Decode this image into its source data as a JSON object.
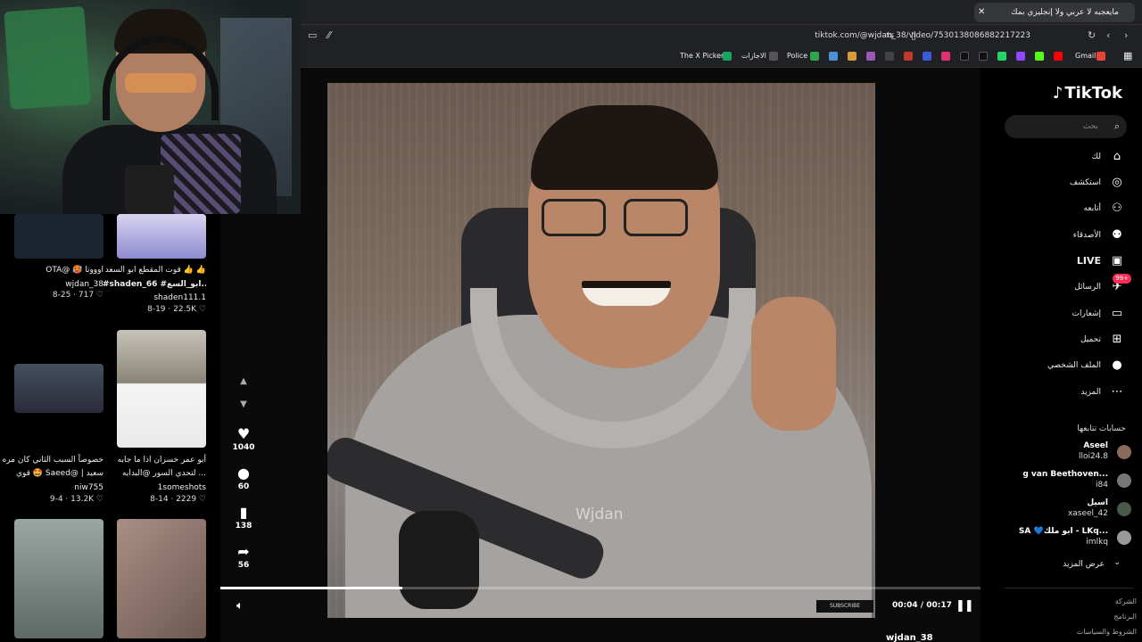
{
  "browser": {
    "tab_title": "مايعجبه لا عربي ولا إنجليزي بمك",
    "tab_close": "✕",
    "new_tab": "+",
    "url": "tiktok.com/@wjdan_38/video/7530138086882217223",
    "bookmarks": [
      "Gmail",
      "Police",
      "الاجازات",
      "The X Picker"
    ]
  },
  "video": {
    "watermark": "Wjdan",
    "subscribe_sticker": "SUBSCRIBE",
    "time": "00:04 / 00:17",
    "progress_fraction": 0.24,
    "author": "wjdan_38"
  },
  "actions": {
    "likes": "1040",
    "comments": "60",
    "saves": "138",
    "shares": "56"
  },
  "grid": {
    "cards": [
      {
        "caption": "OTA@ 🥵 اوووتا",
        "user": "wjdan_38",
        "meta": "8-25 · 717 ♡"
      },
      {
        "caption": "قوت المقطع ابو السعد 👍 👍",
        "caption2": "#shaden_66 #ابو_السع...",
        "user": "shaden111.1",
        "meta": "8-19 · 22.5K ♡"
      },
      {
        "caption": "خصوصاً السبب الثاني كان مره",
        "caption2": "قوي 🤩 Saeed@ | سعيد",
        "user": "niw755",
        "meta": "9-4 · 13.2K ♡"
      },
      {
        "caption": "أبو عمر خسران اذا ما جابه",
        "caption2": "لتحدي السور @البدايه ...",
        "user": "1someshots",
        "meta": "8-14 · 2229 ♡"
      }
    ]
  },
  "sidebar": {
    "logo": "TikTok",
    "search_placeholder": "بحث",
    "items": [
      {
        "label": "لك",
        "icon": "home-icon"
      },
      {
        "label": "استكشف",
        "icon": "compass-icon"
      },
      {
        "label": "أتابعه",
        "icon": "user-follow-icon"
      },
      {
        "label": "الأصدقاء",
        "icon": "friends-icon"
      },
      {
        "label": "LIVE",
        "icon": "live-icon"
      },
      {
        "label": "الرسائل",
        "icon": "messages-icon",
        "badge": "99+"
      },
      {
        "label": "إشعارات",
        "icon": "inbox-icon"
      },
      {
        "label": "تحميل",
        "icon": "upload-icon"
      },
      {
        "label": "الملف الشخصي",
        "icon": "profile-icon"
      },
      {
        "label": "المزيد",
        "icon": "more-icon"
      }
    ],
    "following_title": "حسابات تتابعها",
    "following": [
      {
        "name": "Aseel",
        "handle": "lloi24.8"
      },
      {
        "name": "g van Beethoven...",
        "handle": "i84"
      },
      {
        "name": "اسيل",
        "handle": "xaseel_42"
      },
      {
        "name": "SA 💙ابو ملك - LKq...",
        "handle": "imlkq"
      }
    ],
    "see_more": "عرض المزيد",
    "footer": [
      "الشركة",
      "البرنامج",
      "الشروط والسياسات"
    ]
  }
}
